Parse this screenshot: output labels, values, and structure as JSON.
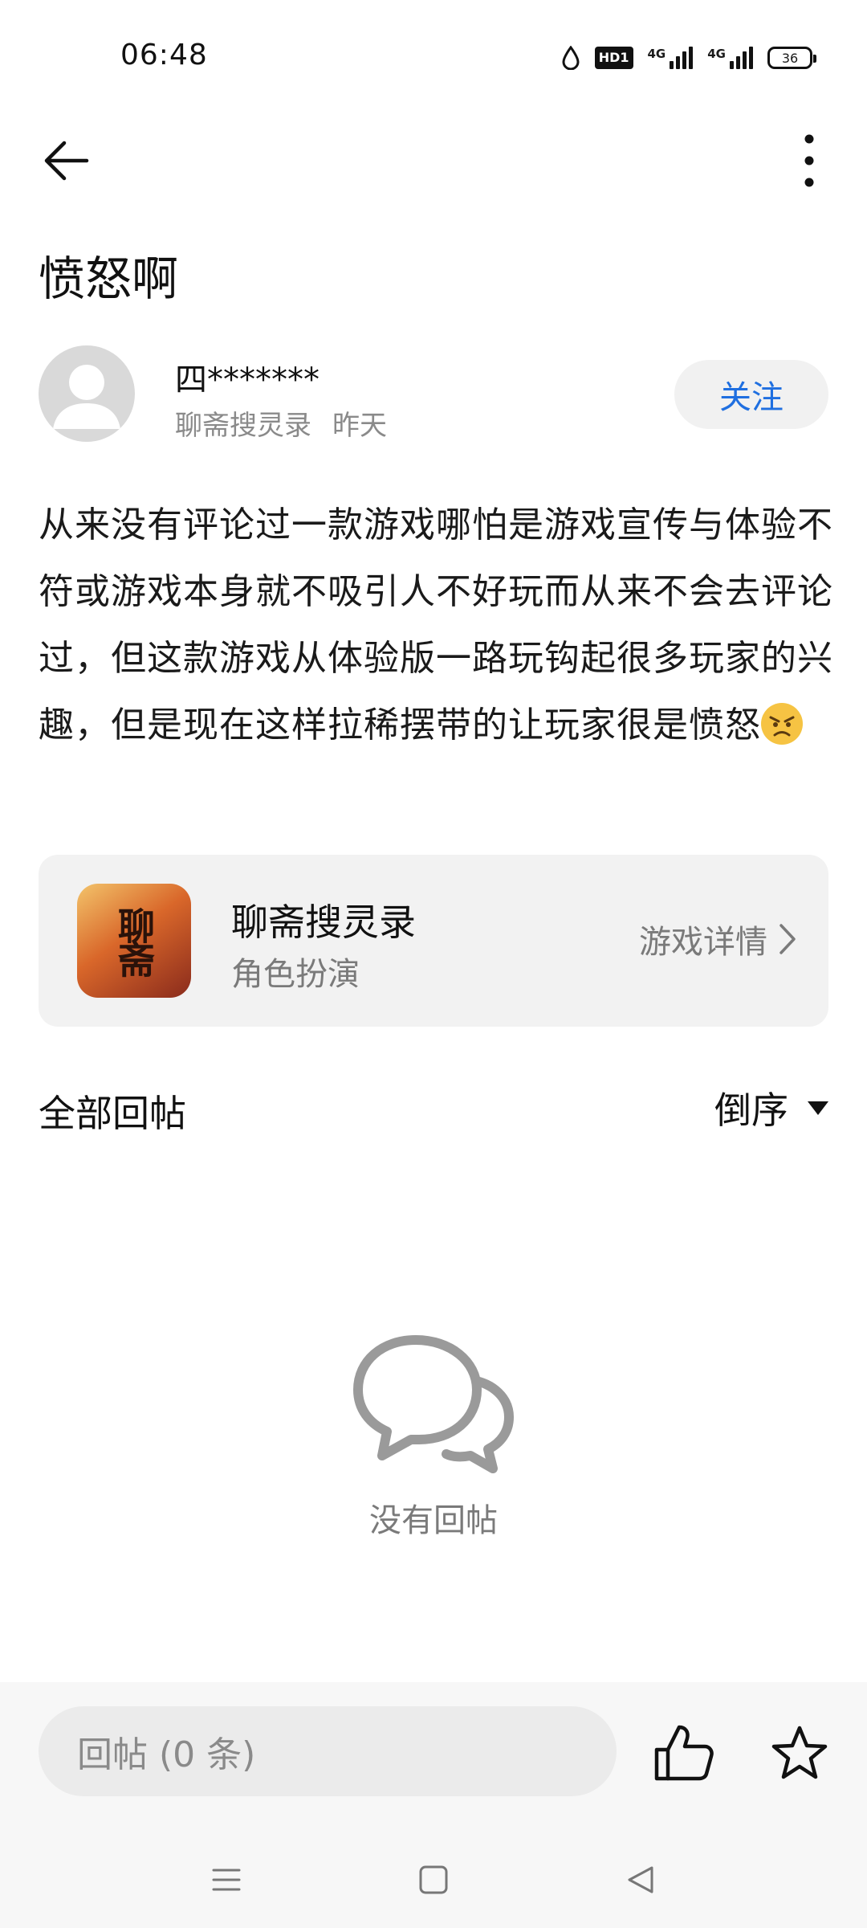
{
  "status_bar": {
    "time": "06:48",
    "hd_label": "HD1",
    "network_1": "4G",
    "network_2": "4G",
    "battery": "36"
  },
  "post": {
    "title": "愤怒啊",
    "author_name": "四*******",
    "author_source": "聊斋搜灵录",
    "posted_time": "昨天",
    "follow_label": "关注",
    "body": "从来没有评论过一款游戏哪怕是游戏宣传与体验不符或游戏本身就不吸引人不好玩而从来不会去评论过，但这款游戏从体验版一路玩钩起很多玩家的兴趣，但是现在这样拉稀摆带的让玩家很是愤怒"
  },
  "game_card": {
    "name": "聊斋搜灵录",
    "genre": "角色扮演",
    "icon_text": "聊斋",
    "detail_link": "游戏详情"
  },
  "replies": {
    "title": "全部回帖",
    "sort_label": "倒序",
    "empty_text": "没有回帖"
  },
  "bottom_bar": {
    "reply_placeholder": "回帖 (0 条)"
  },
  "icons": {
    "back": "arrow-left-icon",
    "more": "more-vertical-icon",
    "emoji": "angry-face-icon",
    "chevron": "chevron-right-icon",
    "sort": "triangle-down-icon",
    "empty": "chat-bubbles-icon",
    "like": "thumbs-up-icon",
    "favorite": "star-icon"
  },
  "colors": {
    "accent": "#1f6fe0",
    "card_bg": "#f2f2f2",
    "muted_text": "#8a8a8a"
  }
}
